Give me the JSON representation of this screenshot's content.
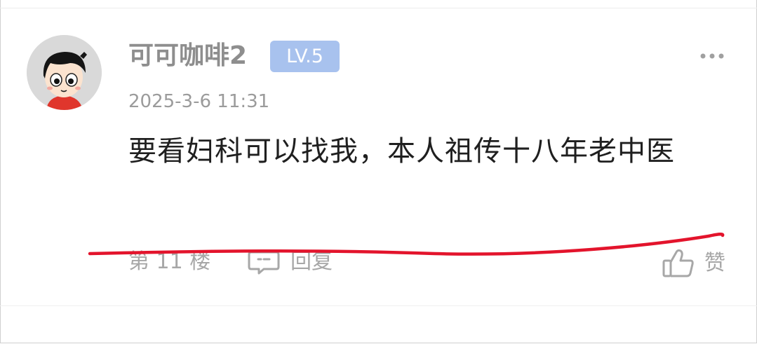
{
  "comment": {
    "username": "可可咖啡2",
    "level_badge": "LV.5",
    "timestamp": "2025-3-6 11:31",
    "content": "要看妇科可以找我，本人祖传十八年老中医",
    "floor": "第 11 楼",
    "reply_label": "回复",
    "like_label": "赞"
  },
  "icons": {
    "more": "more-horizontal-icon",
    "reply": "comment-bubble-icon",
    "like": "thumbs-up-icon"
  },
  "colors": {
    "username": "#8e8e8e",
    "badge_bg": "#a8c2ee",
    "muted_text": "#a7a7a7",
    "content_text": "#1f1f1f",
    "annotation_red": "#e3142c"
  }
}
